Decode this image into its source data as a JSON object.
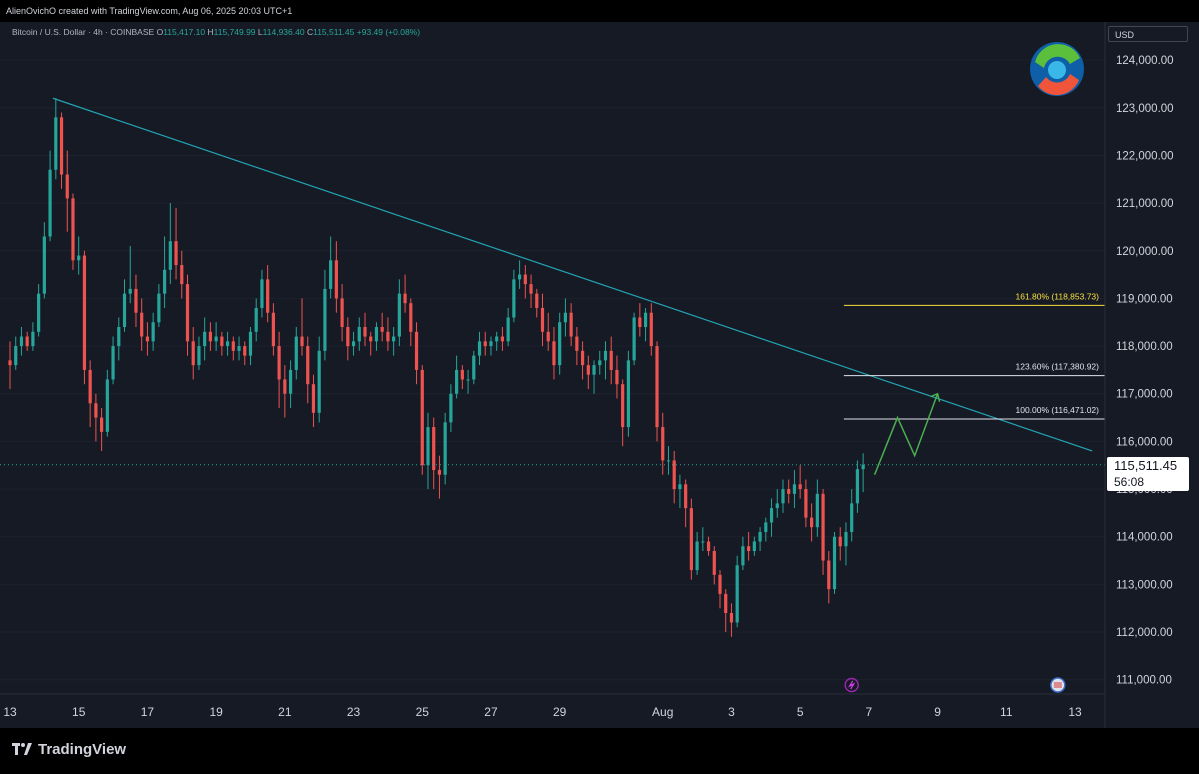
{
  "header": {
    "attribution": "AlienOvichO created with TradingView.com, Aug 06, 2025 20:03 UTC+1"
  },
  "legend": {
    "symbol": "Bitcoin / U.S. Dollar · 4h · COINBASE",
    "open_key": "O",
    "open": "115,417.10",
    "high_key": "H",
    "high": "115,749.99",
    "low_key": "L",
    "low": "114,936.40",
    "close_key": "C",
    "close": "115,511.45",
    "change": "+93.49 (+0.08%)"
  },
  "currency": "USD",
  "price_tag": {
    "price": "115,511.45",
    "countdown": "56:08"
  },
  "footer": {
    "brand": "TradingView"
  },
  "colors": {
    "background": "#161a25",
    "up": "#26a69a",
    "down": "#ef5350",
    "trendline": "#22a6b3",
    "fib_161": "#f7e03c",
    "fib_other": "#e0e3eb",
    "projection": "#4caf50"
  },
  "icons": [
    "tradingview-logo-icon",
    "author-logo-icon",
    "lightning-event-icon",
    "us-flag-event-icon"
  ],
  "chart_data": {
    "type": "candlestick",
    "timeframe": "4h",
    "y_axis": {
      "ticks": [
        "111,000.00",
        "112,000.00",
        "113,000.00",
        "114,000.00",
        "115,000.00",
        "116,000.00",
        "117,000.00",
        "118,000.00",
        "119,000.00",
        "120,000.00",
        "121,000.00",
        "122,000.00",
        "123,000.00",
        "124,000.00"
      ],
      "ylim": [
        110700,
        124800
      ]
    },
    "x_axis": {
      "ticks": [
        "13",
        "15",
        "17",
        "19",
        "21",
        "23",
        "25",
        "27",
        "29",
        "Aug",
        "3",
        "5",
        "7",
        "9",
        "11",
        "13"
      ],
      "start": "2025-07-13",
      "end": "2025-08-13",
      "ticks_at": [
        "2025-07-13",
        "2025-07-15",
        "2025-07-17",
        "2025-07-19",
        "2025-07-21",
        "2025-07-23",
        "2025-07-25",
        "2025-07-27",
        "2025-07-29",
        "2025-08-01",
        "2025-08-03",
        "2025-08-05",
        "2025-08-07",
        "2025-08-09",
        "2025-08-11",
        "2025-08-13"
      ]
    },
    "candles": [
      [
        "2025-07-13 00:00",
        117700,
        118100,
        117100,
        117600
      ],
      [
        "2025-07-13 04:00",
        117600,
        118200,
        117500,
        118000
      ],
      [
        "2025-07-13 08:00",
        118000,
        118400,
        117800,
        118200
      ],
      [
        "2025-07-13 12:00",
        118200,
        118300,
        117900,
        118000
      ],
      [
        "2025-07-13 16:00",
        118000,
        118500,
        117900,
        118300
      ],
      [
        "2025-07-13 20:00",
        118300,
        119300,
        118200,
        119100
      ],
      [
        "2025-07-14 00:00",
        119100,
        120600,
        119000,
        120300
      ],
      [
        "2025-07-14 04:00",
        120300,
        122100,
        120200,
        121700
      ],
      [
        "2025-07-14 08:00",
        121700,
        123200,
        121500,
        122800
      ],
      [
        "2025-07-14 12:00",
        122800,
        122900,
        121300,
        121600
      ],
      [
        "2025-07-14 16:00",
        121600,
        122100,
        120400,
        121100
      ],
      [
        "2025-07-14 20:00",
        121100,
        121200,
        119600,
        119800
      ],
      [
        "2025-07-15 00:00",
        119800,
        120300,
        119500,
        119900
      ],
      [
        "2025-07-15 04:00",
        119900,
        120000,
        117200,
        117500
      ],
      [
        "2025-07-15 08:00",
        117500,
        117700,
        116300,
        116800
      ],
      [
        "2025-07-15 12:00",
        116800,
        117000,
        116000,
        116500
      ],
      [
        "2025-07-15 16:00",
        116500,
        116700,
        115800,
        116200
      ],
      [
        "2025-07-15 20:00",
        116200,
        117500,
        116100,
        117300
      ],
      [
        "2025-07-16 00:00",
        117300,
        118200,
        117200,
        118000
      ],
      [
        "2025-07-16 04:00",
        118000,
        118600,
        117700,
        118400
      ],
      [
        "2025-07-16 08:00",
        118400,
        119400,
        118300,
        119100
      ],
      [
        "2025-07-16 12:00",
        119100,
        120100,
        118900,
        119200
      ],
      [
        "2025-07-16 16:00",
        119200,
        119500,
        118400,
        118700
      ],
      [
        "2025-07-16 20:00",
        118700,
        119000,
        117900,
        118200
      ],
      [
        "2025-07-17 00:00",
        118200,
        118500,
        117800,
        118100
      ],
      [
        "2025-07-17 04:00",
        118100,
        118700,
        117900,
        118500
      ],
      [
        "2025-07-17 08:00",
        118500,
        119300,
        118400,
        119100
      ],
      [
        "2025-07-17 12:00",
        119100,
        120300,
        118800,
        119600
      ],
      [
        "2025-07-17 16:00",
        119600,
        121000,
        119300,
        120200
      ],
      [
        "2025-07-17 20:00",
        120200,
        120900,
        119400,
        119700
      ],
      [
        "2025-07-18 00:00",
        119700,
        120000,
        119000,
        119300
      ],
      [
        "2025-07-18 04:00",
        119300,
        119500,
        117800,
        118100
      ],
      [
        "2025-07-18 08:00",
        118100,
        118400,
        117300,
        117600
      ],
      [
        "2025-07-18 12:00",
        117600,
        118200,
        117500,
        118000
      ],
      [
        "2025-07-18 16:00",
        118000,
        118600,
        117700,
        118300
      ],
      [
        "2025-07-18 20:00",
        118300,
        118500,
        117900,
        118100
      ],
      [
        "2025-07-19 00:00",
        118100,
        118500,
        117900,
        118200
      ],
      [
        "2025-07-19 04:00",
        118200,
        118300,
        117800,
        118000
      ],
      [
        "2025-07-19 08:00",
        118000,
        118300,
        117800,
        118100
      ],
      [
        "2025-07-19 12:00",
        118100,
        118200,
        117700,
        117900
      ],
      [
        "2025-07-19 16:00",
        117900,
        118200,
        117700,
        118000
      ],
      [
        "2025-07-19 20:00",
        118000,
        118100,
        117600,
        117800
      ],
      [
        "2025-07-20 00:00",
        117800,
        118400,
        117600,
        118300
      ],
      [
        "2025-07-20 04:00",
        118300,
        119000,
        118100,
        118800
      ],
      [
        "2025-07-20 08:00",
        118800,
        119600,
        118600,
        119400
      ],
      [
        "2025-07-20 12:00",
        119400,
        119700,
        118500,
        118700
      ],
      [
        "2025-07-20 16:00",
        118700,
        118900,
        117800,
        118000
      ],
      [
        "2025-07-20 20:00",
        118000,
        118300,
        116700,
        117300
      ],
      [
        "2025-07-21 00:00",
        117300,
        117600,
        116500,
        117000
      ],
      [
        "2025-07-21 04:00",
        117000,
        117700,
        116700,
        117500
      ],
      [
        "2025-07-21 08:00",
        117500,
        118400,
        117300,
        118200
      ],
      [
        "2025-07-21 12:00",
        118200,
        119000,
        117800,
        118000
      ],
      [
        "2025-07-21 16:00",
        118000,
        118200,
        116800,
        117200
      ],
      [
        "2025-07-21 20:00",
        117200,
        117400,
        116300,
        116600
      ],
      [
        "2025-07-22 00:00",
        116600,
        118200,
        116400,
        117900
      ],
      [
        "2025-07-22 04:00",
        117900,
        119600,
        117700,
        119200
      ],
      [
        "2025-07-22 08:00",
        119200,
        120300,
        119000,
        119800
      ],
      [
        "2025-07-22 12:00",
        119800,
        120200,
        118700,
        119000
      ],
      [
        "2025-07-22 16:00",
        119000,
        119300,
        118100,
        118400
      ],
      [
        "2025-07-22 20:00",
        118400,
        118600,
        117700,
        118000
      ],
      [
        "2025-07-23 00:00",
        118000,
        118300,
        117800,
        118100
      ],
      [
        "2025-07-23 04:00",
        118100,
        118600,
        117900,
        118400
      ],
      [
        "2025-07-23 08:00",
        118400,
        118700,
        118000,
        118200
      ],
      [
        "2025-07-23 12:00",
        118200,
        118300,
        117800,
        118100
      ],
      [
        "2025-07-23 16:00",
        118100,
        118500,
        117900,
        118400
      ],
      [
        "2025-07-23 20:00",
        118400,
        118700,
        118100,
        118300
      ],
      [
        "2025-07-24 00:00",
        118300,
        118600,
        117900,
        118100
      ],
      [
        "2025-07-24 04:00",
        118100,
        118400,
        117800,
        118200
      ],
      [
        "2025-07-24 08:00",
        118200,
        119400,
        118000,
        119100
      ],
      [
        "2025-07-24 12:00",
        119100,
        119500,
        118700,
        118900
      ],
      [
        "2025-07-24 16:00",
        118900,
        119000,
        118000,
        118300
      ],
      [
        "2025-07-24 20:00",
        118300,
        118500,
        117200,
        117500
      ],
      [
        "2025-07-25 00:00",
        117500,
        117600,
        115300,
        115500
      ],
      [
        "2025-07-25 04:00",
        115500,
        116600,
        115000,
        116300
      ],
      [
        "2025-07-25 08:00",
        116300,
        116500,
        115000,
        115400
      ],
      [
        "2025-07-25 12:00",
        115400,
        115700,
        114800,
        115300
      ],
      [
        "2025-07-25 16:00",
        115300,
        116600,
        115100,
        116400
      ],
      [
        "2025-07-25 20:00",
        116400,
        117200,
        116200,
        117000
      ],
      [
        "2025-07-26 00:00",
        117000,
        117800,
        116900,
        117500
      ],
      [
        "2025-07-26 04:00",
        117500,
        117600,
        117100,
        117300
      ],
      [
        "2025-07-26 08:00",
        117300,
        117500,
        117000,
        117300
      ],
      [
        "2025-07-26 12:00",
        117300,
        117900,
        117200,
        117800
      ],
      [
        "2025-07-26 16:00",
        117800,
        118300,
        117600,
        118100
      ],
      [
        "2025-07-26 20:00",
        118100,
        118300,
        117800,
        118000
      ],
      [
        "2025-07-27 00:00",
        118000,
        118200,
        117800,
        118100
      ],
      [
        "2025-07-27 04:00",
        118100,
        118300,
        117900,
        118200
      ],
      [
        "2025-07-27 08:00",
        118200,
        118400,
        117900,
        118100
      ],
      [
        "2025-07-27 12:00",
        118100,
        118800,
        118000,
        118600
      ],
      [
        "2025-07-27 16:00",
        118600,
        119600,
        118500,
        119400
      ],
      [
        "2025-07-27 20:00",
        119400,
        119800,
        119200,
        119500
      ],
      [
        "2025-07-28 00:00",
        119500,
        119700,
        119000,
        119300
      ],
      [
        "2025-07-28 04:00",
        119300,
        119500,
        118800,
        119100
      ],
      [
        "2025-07-28 08:00",
        119100,
        119200,
        118600,
        118800
      ],
      [
        "2025-07-28 12:00",
        118800,
        119100,
        118000,
        118300
      ],
      [
        "2025-07-28 16:00",
        118300,
        118700,
        117900,
        118100
      ],
      [
        "2025-07-28 20:00",
        118100,
        118400,
        117300,
        117600
      ],
      [
        "2025-07-29 00:00",
        117600,
        118700,
        117400,
        118500
      ],
      [
        "2025-07-29 04:00",
        118500,
        119000,
        118200,
        118700
      ],
      [
        "2025-07-29 08:00",
        118700,
        118900,
        118000,
        118200
      ],
      [
        "2025-07-29 12:00",
        118200,
        118400,
        117600,
        117900
      ],
      [
        "2025-07-29 16:00",
        117900,
        118100,
        117300,
        117600
      ],
      [
        "2025-07-29 20:00",
        117600,
        117800,
        117100,
        117400
      ],
      [
        "2025-07-30 00:00",
        117400,
        117700,
        117000,
        117600
      ],
      [
        "2025-07-30 04:00",
        117600,
        117900,
        117400,
        117700
      ],
      [
        "2025-07-30 08:00",
        117700,
        118100,
        117300,
        117900
      ],
      [
        "2025-07-30 12:00",
        117900,
        118200,
        117200,
        117500
      ],
      [
        "2025-07-30 16:00",
        117500,
        117800,
        116900,
        117200
      ],
      [
        "2025-07-30 20:00",
        117200,
        117300,
        115900,
        116300
      ],
      [
        "2025-07-31 00:00",
        116300,
        117900,
        116100,
        117700
      ],
      [
        "2025-07-31 04:00",
        117700,
        118700,
        117600,
        118600
      ],
      [
        "2025-07-31 08:00",
        118600,
        118900,
        118200,
        118400
      ],
      [
        "2025-07-31 12:00",
        118400,
        118800,
        118100,
        118700
      ],
      [
        "2025-07-31 16:00",
        118700,
        118900,
        117800,
        118000
      ],
      [
        "2025-07-31 20:00",
        118000,
        118100,
        116000,
        116300
      ],
      [
        "2025-08-01 00:00",
        116300,
        116600,
        115300,
        115600
      ],
      [
        "2025-08-01 04:00",
        115600,
        115900,
        115300,
        115600
      ],
      [
        "2025-08-01 08:00",
        115600,
        115800,
        114700,
        115000
      ],
      [
        "2025-08-01 12:00",
        115000,
        115300,
        114600,
        115100
      ],
      [
        "2025-08-01 16:00",
        115100,
        115200,
        114200,
        114600
      ],
      [
        "2025-08-01 20:00",
        114600,
        114800,
        113100,
        113300
      ],
      [
        "2025-08-02 00:00",
        113300,
        114100,
        113200,
        113900
      ],
      [
        "2025-08-02 04:00",
        113900,
        114200,
        113700,
        113900
      ],
      [
        "2025-08-02 08:00",
        113900,
        114000,
        113600,
        113700
      ],
      [
        "2025-08-02 12:00",
        113700,
        113800,
        113000,
        113200
      ],
      [
        "2025-08-02 16:00",
        113200,
        113300,
        112500,
        112800
      ],
      [
        "2025-08-02 20:00",
        112800,
        112900,
        112000,
        112400
      ],
      [
        "2025-08-03 00:00",
        112400,
        112600,
        111900,
        112200
      ],
      [
        "2025-08-03 04:00",
        112200,
        113600,
        112100,
        113400
      ],
      [
        "2025-08-03 08:00",
        113400,
        114000,
        113300,
        113800
      ],
      [
        "2025-08-03 12:00",
        113800,
        114100,
        113500,
        113700
      ],
      [
        "2025-08-03 16:00",
        113700,
        114000,
        113600,
        113900
      ],
      [
        "2025-08-03 20:00",
        113900,
        114200,
        113700,
        114100
      ],
      [
        "2025-08-04 00:00",
        114100,
        114400,
        113900,
        114300
      ],
      [
        "2025-08-04 04:00",
        114300,
        114800,
        114000,
        114600
      ],
      [
        "2025-08-04 08:00",
        114600,
        115000,
        114400,
        114700
      ],
      [
        "2025-08-04 12:00",
        114700,
        115200,
        114500,
        115000
      ],
      [
        "2025-08-04 16:00",
        115000,
        115200,
        114700,
        114900
      ],
      [
        "2025-08-04 20:00",
        114900,
        115400,
        114600,
        115100
      ],
      [
        "2025-08-05 00:00",
        115100,
        115500,
        114800,
        115000
      ],
      [
        "2025-08-05 04:00",
        115000,
        115200,
        114200,
        114400
      ],
      [
        "2025-08-05 08:00",
        114400,
        114700,
        113900,
        114200
      ],
      [
        "2025-08-05 12:00",
        114200,
        115200,
        114000,
        114900
      ],
      [
        "2025-08-05 16:00",
        114900,
        115000,
        113200,
        113500
      ],
      [
        "2025-08-05 20:00",
        113500,
        113700,
        112600,
        112900
      ],
      [
        "2025-08-06 00:00",
        112900,
        114100,
        112800,
        114000
      ],
      [
        "2025-08-06 04:00",
        114000,
        114200,
        113500,
        113800
      ],
      [
        "2025-08-06 08:00",
        113800,
        114300,
        113400,
        114100
      ],
      [
        "2025-08-06 12:00",
        114100,
        115000,
        113900,
        114700
      ],
      [
        "2025-08-06 16:00",
        114700,
        115600,
        114500,
        115417.1
      ],
      [
        "2025-08-06 20:00",
        115417.1,
        115749.99,
        114936.4,
        115511.45
      ]
    ],
    "trendline": {
      "from": [
        "2025-07-14 06:00",
        123200
      ],
      "to": [
        "2025-08-13 12:00",
        115800
      ]
    },
    "fib_levels": [
      {
        "label": "161.80% (118,853.73)",
        "value": 118853.73,
        "color": "#f7e03c"
      },
      {
        "label": "123.60% (117,380.92)",
        "value": 117380.92,
        "color": "#e0e3eb"
      },
      {
        "label": "100.00% (116,471.02)",
        "value": 116471.02,
        "color": "#e0e3eb"
      }
    ],
    "fib_range": [
      "2025-08-07 00:00",
      "2025-08-13 12:00"
    ],
    "last_price": 115511.45,
    "projection_path": [
      [
        "2025-08-07 04:00",
        115300
      ],
      [
        "2025-08-07 20:00",
        116500
      ],
      [
        "2025-08-08 08:00",
        115700
      ],
      [
        "2025-08-09 00:00",
        117000
      ]
    ],
    "events": [
      {
        "icon": "lightning-event-icon",
        "at": "2025-08-06 12:00"
      },
      {
        "icon": "us-flag-event-icon",
        "at": "2025-08-12 12:00"
      }
    ]
  }
}
